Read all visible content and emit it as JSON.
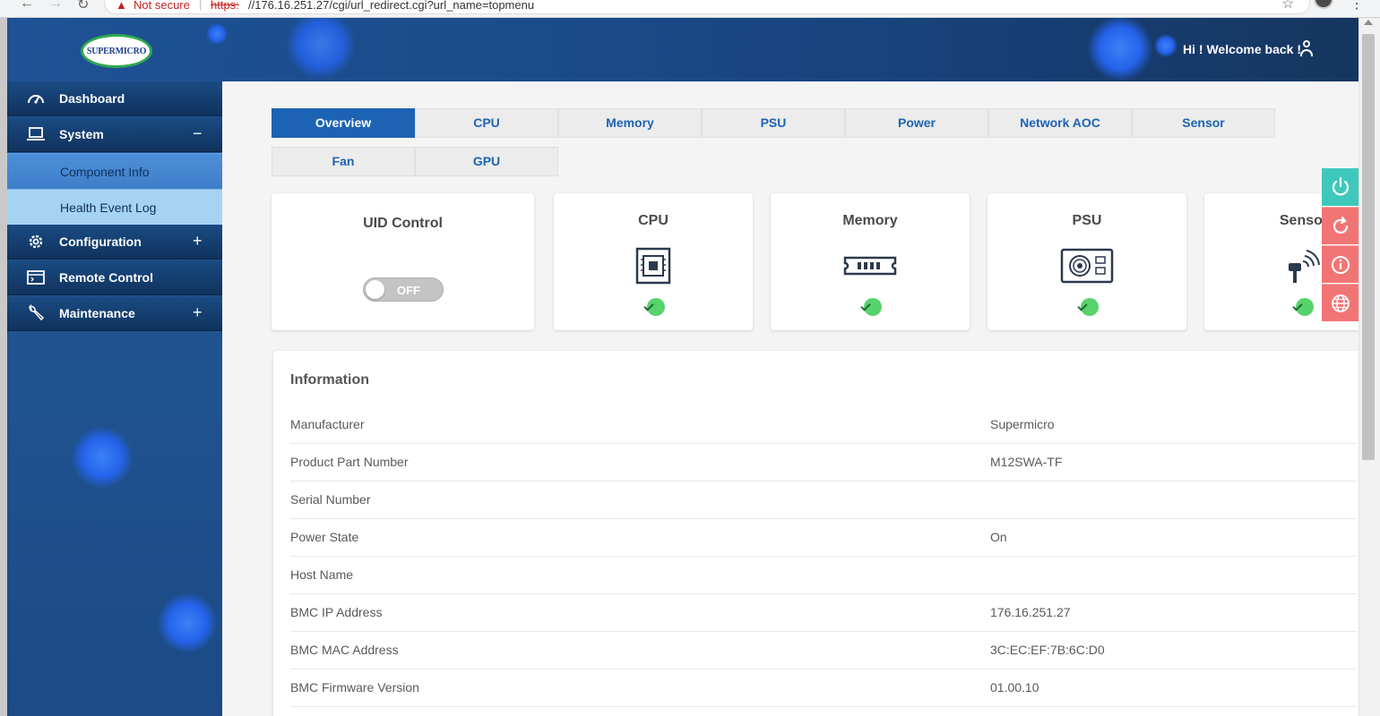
{
  "browser": {
    "security_warning": "Not secure",
    "scheme": "https:",
    "url": "//176.16.251.27/cgi/url_redirect.cgi?url_name=topmenu"
  },
  "header": {
    "logo_text": "SUPERMICRO",
    "welcome": "Hi ! Welcome back !"
  },
  "sidebar": {
    "items": [
      {
        "label": "Dashboard",
        "icon": "dashboard-gauge-icon"
      },
      {
        "label": "System",
        "icon": "laptop-icon",
        "toggle": "−"
      },
      {
        "label": "Component Info"
      },
      {
        "label": "Health Event Log"
      },
      {
        "label": "Configuration",
        "icon": "gear-icon",
        "toggle": "+"
      },
      {
        "label": "Remote Control",
        "icon": "console-window-icon"
      },
      {
        "label": "Maintenance",
        "icon": "wrench-icon",
        "toggle": "+"
      }
    ]
  },
  "tabs": [
    "Overview",
    "CPU",
    "Memory",
    "PSU",
    "Power",
    "Network AOC",
    "Sensor",
    "Fan",
    "GPU"
  ],
  "active_tab": "Overview",
  "uid_card": {
    "title": "UID Control",
    "toggle_state": "OFF"
  },
  "status_cards": [
    {
      "title": "CPU",
      "icon": "cpu-chip-icon",
      "status": "ok"
    },
    {
      "title": "Memory",
      "icon": "memory-module-icon",
      "status": "ok"
    },
    {
      "title": "PSU",
      "icon": "power-supply-icon",
      "status": "ok"
    },
    {
      "title": "Sensor",
      "icon": "sensor-probe-icon",
      "status": "ok"
    }
  ],
  "information": {
    "title": "Information",
    "rows": [
      {
        "label": "Manufacturer",
        "value": "Supermicro"
      },
      {
        "label": "Product Part Number",
        "value": "M12SWA-TF"
      },
      {
        "label": "Serial Number",
        "value": ""
      },
      {
        "label": "Power State",
        "value": "On"
      },
      {
        "label": "Host Name",
        "value": ""
      },
      {
        "label": "BMC IP Address",
        "value": "176.16.251.27"
      },
      {
        "label": "BMC MAC Address",
        "value": "3C:EC:EF:7B:6C:D0"
      },
      {
        "label": "BMC Firmware Version",
        "value": "01.00.10"
      }
    ]
  },
  "quick_actions": [
    "power-icon",
    "refresh-icon",
    "info-icon",
    "globe-icon"
  ],
  "colors": {
    "accent": "#1d63b3",
    "banner": "#1e5296",
    "status_ok": "#58d36b",
    "fab_teal": "#3ec8bb",
    "fab_red": "#f27575"
  }
}
